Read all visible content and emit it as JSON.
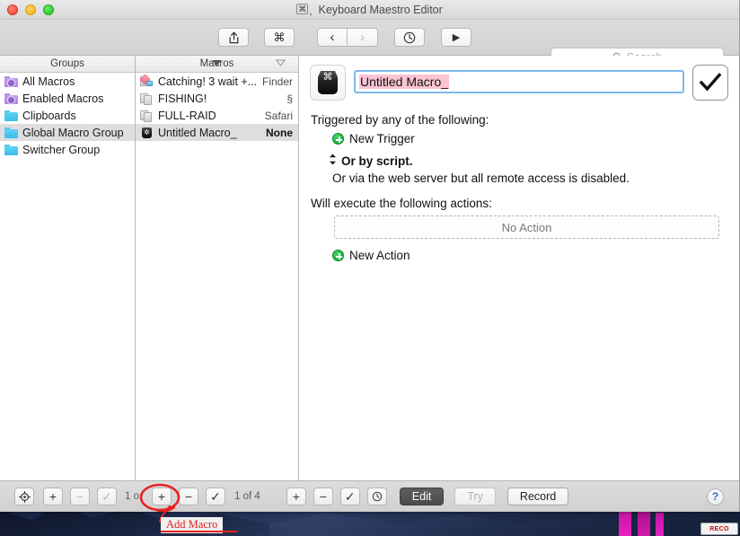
{
  "window": {
    "title": "Keyboard Maestro Editor",
    "title_icon": "command-key-icon",
    "traffic_lights": [
      "close",
      "minimize",
      "zoom"
    ]
  },
  "toolbar": {
    "share_label": "⬆",
    "share_icon": "share-icon",
    "cmd_label": "⌘",
    "cmd_icon": "command-icon",
    "back_label": "‹",
    "forward_label": "›",
    "clock_icon": "clock-icon",
    "play_label": "▶",
    "search": {
      "placeholder": "Search",
      "value": "",
      "icon": "search-icon"
    }
  },
  "groups_column": {
    "header": "Groups",
    "items": [
      {
        "label": "All Macros",
        "icon": "smart-group-folder-icon",
        "kind": "smart",
        "selected": false
      },
      {
        "label": "Enabled Macros",
        "icon": "smart-group-folder-icon",
        "kind": "smart",
        "selected": false
      },
      {
        "label": "Clipboards",
        "icon": "folder-icon",
        "kind": "normal",
        "selected": false
      },
      {
        "label": "Global Macro Group",
        "icon": "folder-icon",
        "kind": "normal",
        "selected": true
      },
      {
        "label": "Switcher Group",
        "icon": "folder-icon",
        "kind": "normal",
        "selected": false
      }
    ]
  },
  "macros_column": {
    "header": "Macros",
    "sort_left_icon": "triangle-down-filled-icon",
    "sort_right_icon": "triangle-down-outline-icon",
    "items": [
      {
        "label": "Catching! 3 wait +...",
        "trailing": "Finder",
        "icon": "macro-trigger-icon",
        "selected": false
      },
      {
        "label": "FISHING!",
        "trailing": "§",
        "icon": "macro-doc-icon",
        "selected": false
      },
      {
        "label": "FULL-RAID",
        "trailing": "Safari",
        "icon": "macro-doc-icon",
        "selected": false
      },
      {
        "label": "Untitled Macro_",
        "trailing": "None",
        "icon": "macro-keycap-icon",
        "selected": true
      }
    ]
  },
  "editor": {
    "macro_icon": "keycap-command-icon",
    "name_value": "Untitled Macro_",
    "confirm_icon": "checkmark-icon",
    "triggered_heading": "Triggered by any of the following:",
    "new_trigger_label": "New Trigger",
    "new_trigger_icon": "plus-circle-green-icon",
    "or_by_script_label": "Or by script.",
    "or_by_script_icon": "updown-arrows-icon",
    "web_server_label": "Or via the web server but all remote access is disabled.",
    "will_execute_heading": "Will execute the following actions:",
    "no_action_label": "No Action",
    "new_action_label": "New Action",
    "new_action_icon": "plus-circle-green-icon"
  },
  "bottom_bar": {
    "groups_gear_icon": "target-gear-icon",
    "groups_add_label": "+",
    "groups_remove_label": "−",
    "groups_check_label": "✓",
    "groups_count": "1 o",
    "macros_add_label": "+",
    "macros_remove_label": "−",
    "macros_check_label": "✓",
    "macros_count": "1 of 4",
    "actions_add_label": "+",
    "actions_remove_label": "−",
    "actions_check_label": "✓",
    "actions_clock_icon": "clock-icon",
    "edit_label": "Edit",
    "try_label": "Try",
    "record_label": "Record",
    "help_label": "?"
  },
  "annotation": {
    "label": "Add Macro",
    "color": "#e8211f",
    "circled_target": "macros-add-button"
  },
  "desktop": {
    "badge_text": "RECO"
  }
}
